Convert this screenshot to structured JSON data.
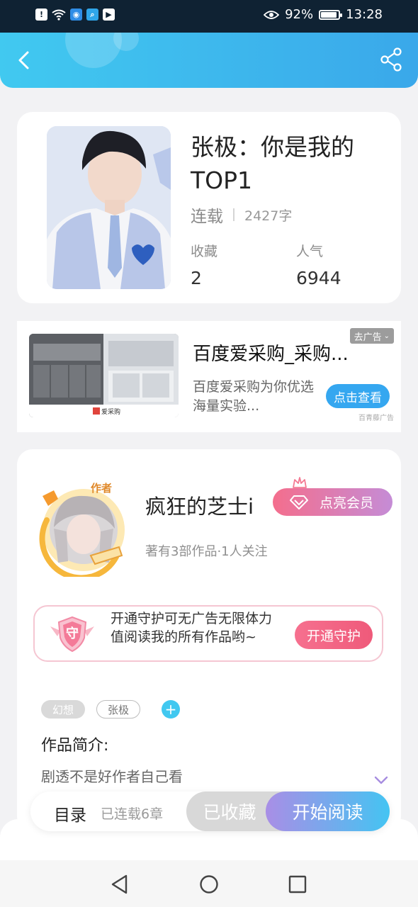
{
  "status_bar": {
    "battery": "92%",
    "battery_level": 0.92,
    "time": "13:28"
  },
  "book": {
    "title": "张极：你是我的TOP1",
    "status": "连载",
    "word_count": "2427字",
    "favorites_label": "收藏",
    "favorites_value": "2",
    "popularity_label": "人气",
    "popularity_value": "6944"
  },
  "ad": {
    "close_label": "去广告",
    "title": "百度爱采购_采购...",
    "description": "百度爱采购为你优选海量实验...",
    "cta": "点击查看",
    "source": "百青藤广告",
    "image_logo_text": "爱采购"
  },
  "author": {
    "badge": "作者",
    "name": "疯狂的芝士i",
    "vip_button": "点亮会员",
    "meta": "著有3部作品·1人关注",
    "guard_icon_text": "守",
    "guard_text": "开通守护可无广告无限体力值阅读我的所有作品哟~",
    "guard_button": "开通守护"
  },
  "tags": [
    "幻想",
    "张极"
  ],
  "intro": {
    "label": "作品简介:",
    "text": "剧透不是好作者自己看"
  },
  "bottom_bar": {
    "toc_label": "目录",
    "toc_count": "已连载6章",
    "favorited": "已收藏",
    "start_reading": "开始阅读"
  },
  "colors": {
    "header_start": "#41c9f0",
    "header_end": "#3aa8ea",
    "vip_start": "#f46e8d",
    "vip_end": "#c58cd6",
    "read_start": "#a98ee6",
    "read_end": "#44c4f2",
    "accent": "#41c8f0"
  },
  "icons": [
    "back-icon",
    "share-icon",
    "eye-icon",
    "wifi-icon",
    "diamond-icon",
    "crown-icon",
    "shield-icon",
    "plus-icon",
    "chevron-down-icon",
    "nav-back-icon",
    "nav-home-icon",
    "nav-recents-icon"
  ]
}
